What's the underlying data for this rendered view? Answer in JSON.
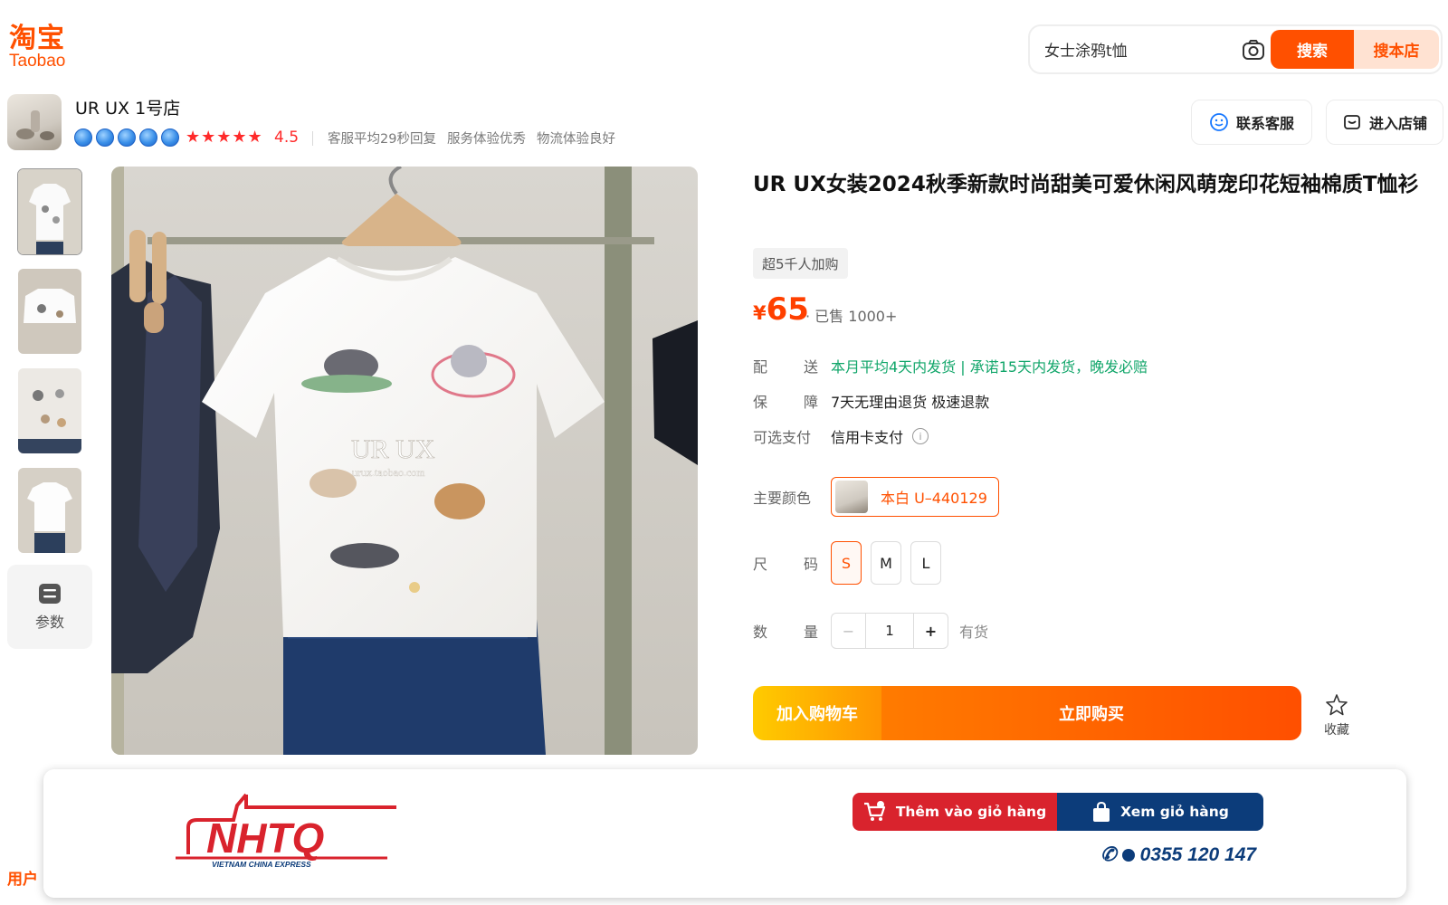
{
  "header": {
    "logo_cn": "淘宝",
    "logo_en": "Taobao",
    "search_value": "女士涂鸦t恤",
    "search_button": "搜索",
    "search_store_button": "搜本店"
  },
  "store": {
    "name": "UR UX 1号店",
    "rating": "4.5",
    "meta": [
      "客服平均29秒回复",
      "服务体验优秀",
      "物流体验良好"
    ],
    "contact_button": "联系客服",
    "enter_button": "进入店铺"
  },
  "gallery": {
    "params_label": "参数",
    "watermark_brand": "UR UX",
    "watermark_url": "urux.taobao.com"
  },
  "product": {
    "title": "UR UX女装2024秋季新款时尚甜美可爱休闲风萌宠印花短袖棉质T恤衫",
    "tag": "超5千人加购",
    "currency": "¥",
    "price": "65",
    "sold": "· 已售 1000+",
    "shipping_label_a": "配",
    "shipping_label_b": "送",
    "shipping_value": "本月平均4天内发货 | 承诺15天内发货，晚发必赔",
    "guarantee_label_a": "保",
    "guarantee_label_b": "障",
    "guarantee_value": "7天无理由退货 极速退款",
    "payment_label": "可选支付",
    "payment_value": "信用卡支付",
    "color_label": "主要颜色",
    "color_option": "本白 U–440129",
    "size_label_a": "尺",
    "size_label_b": "码",
    "sizes": [
      "S",
      "M",
      "L"
    ],
    "qty_label_a": "数",
    "qty_label_b": "量",
    "qty_minus": "−",
    "qty_value": "1",
    "qty_plus": "+",
    "stock": "有货",
    "add_cart": "加入购物车",
    "buy_now": "立即购买",
    "favorite": "收藏"
  },
  "banner": {
    "add_cart": "Thêm vào giỏ hàng",
    "view_cart": "Xem giỏ hàng",
    "phone": "0355 120 147",
    "logo_text": "NHTQ",
    "logo_sub": "VIETNAM CHINA EXPRESS"
  },
  "footer": {
    "user_link": "用户"
  },
  "colors": {
    "accent": "#ff5000",
    "price": "#ff4000",
    "green": "#11a66a",
    "banner_red": "#d9232d",
    "banner_blue": "#0c3c7a"
  }
}
